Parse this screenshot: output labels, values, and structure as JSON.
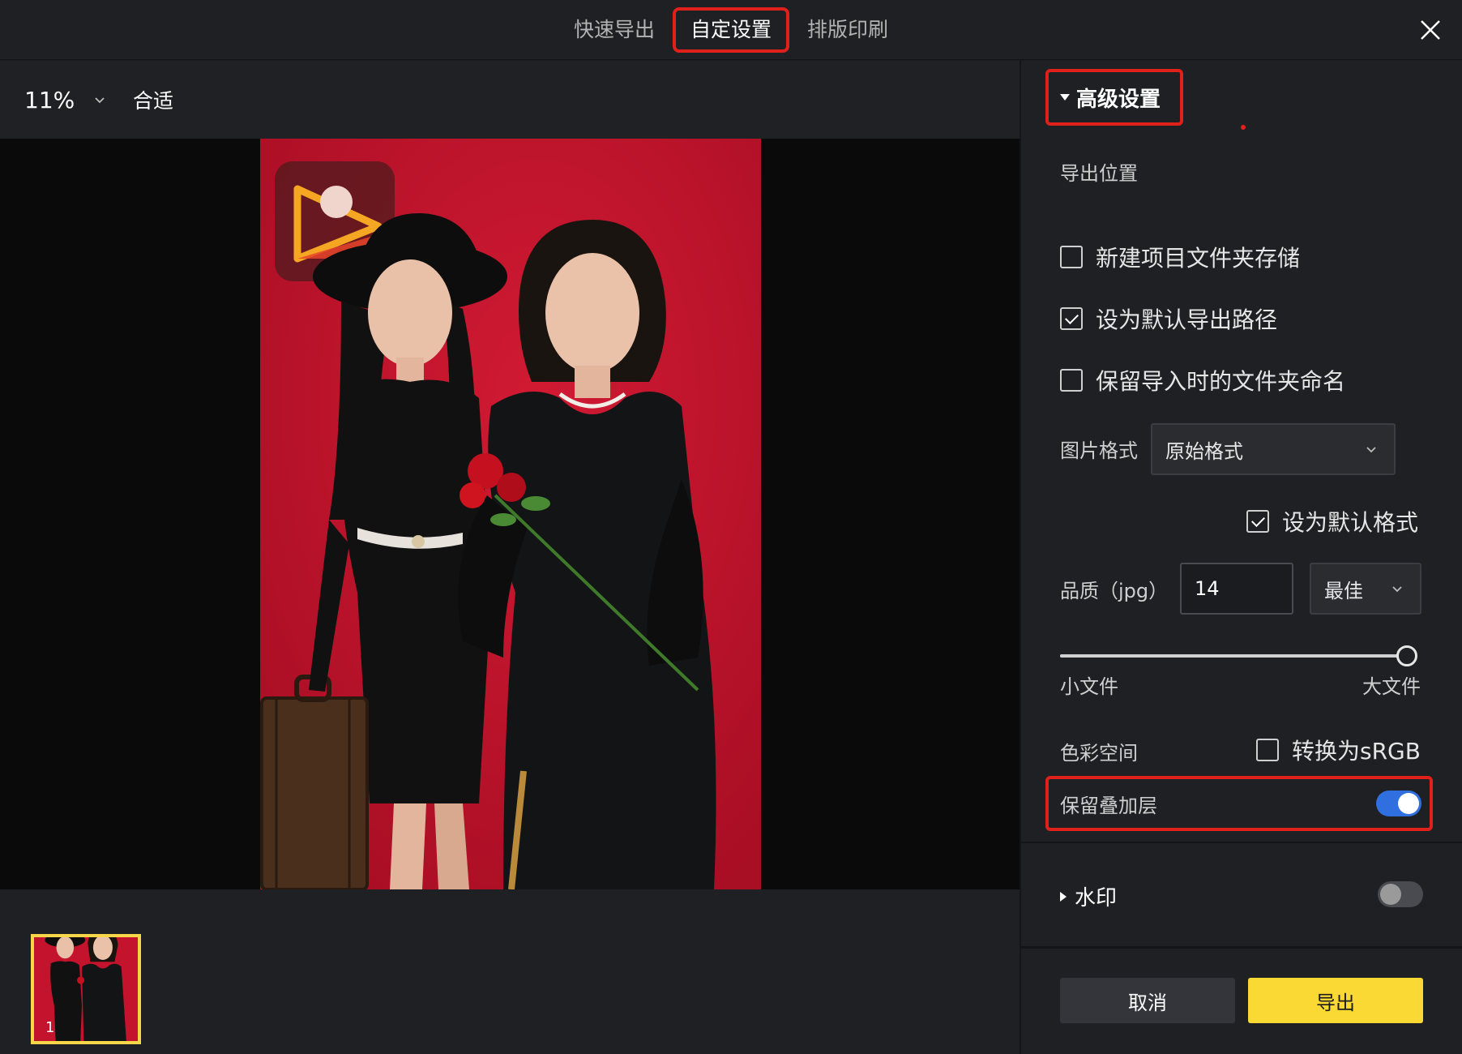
{
  "tabs": [
    {
      "label": "快速导出",
      "active": false
    },
    {
      "label": "自定设置",
      "active": true
    },
    {
      "label": "排版印刷",
      "active": false
    }
  ],
  "preview": {
    "zoom": "11%",
    "fit_label": "合适",
    "thumbnail_index": "1"
  },
  "panel": {
    "advanced_title": "高级设置",
    "export_location_label": "导出位置",
    "checkboxes": {
      "new_project_folder": {
        "label": "新建项目文件夹存储",
        "checked": false
      },
      "default_export_path": {
        "label": "设为默认导出路径",
        "checked": true
      },
      "keep_folder_name": {
        "label": "保留导入时的文件夹命名",
        "checked": false
      }
    },
    "image_format_label": "图片格式",
    "image_format_value": "原始格式",
    "default_format": {
      "label": "设为默认格式",
      "checked": true
    },
    "quality_label": "品质（jpg）",
    "quality_value": "14",
    "quality_preset": "最佳",
    "quality_slider_fraction": 1.0,
    "slider_min_label": "小文件",
    "slider_max_label": "大文件",
    "color_space_label": "色彩空间",
    "convert_srgb": {
      "label": "转换为sRGB",
      "checked": false
    },
    "keep_overlay_label": "保留叠加层",
    "keep_overlay_on": true,
    "watermark_title": "水印",
    "watermark_on": false
  },
  "buttons": {
    "cancel": "取消",
    "export": "导出"
  },
  "colors": {
    "accent_blue": "#2f6fe0",
    "export_yellow": "#fbd934",
    "highlight_red": "#e0201b",
    "photo_background": "#c4132c"
  }
}
